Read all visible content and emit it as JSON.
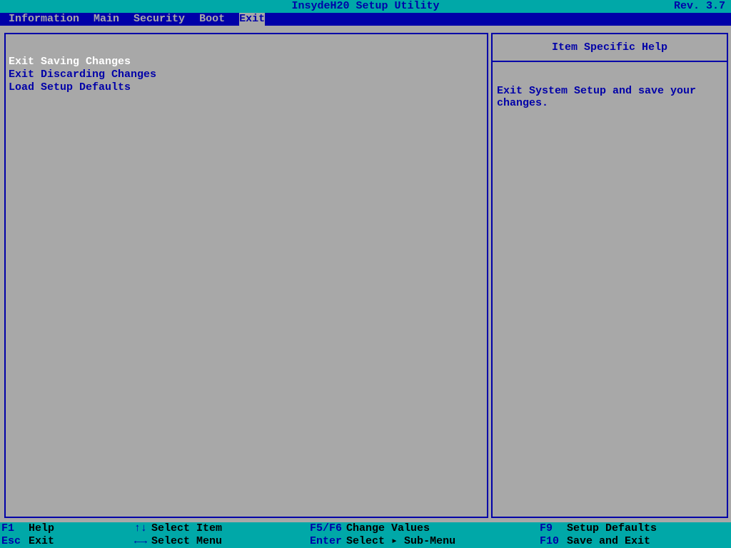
{
  "header": {
    "title": "InsydeH20 Setup Utility",
    "revision": "Rev. 3.7"
  },
  "menus": [
    {
      "label": "Information",
      "selected": false
    },
    {
      "label": "Main",
      "selected": false
    },
    {
      "label": "Security",
      "selected": false
    },
    {
      "label": "Boot",
      "selected": false
    },
    {
      "label": "Exit",
      "selected": true
    }
  ],
  "main": {
    "options": [
      {
        "label": "Exit Saving Changes",
        "selected": true
      },
      {
        "label": "Exit Discarding Changes",
        "selected": false
      },
      {
        "label": "Load Setup Defaults",
        "selected": false
      }
    ]
  },
  "help": {
    "title": "Item Specific Help",
    "body": "Exit System Setup and save your changes."
  },
  "footer": {
    "r1c1": {
      "key": "F1",
      "label": "Help"
    },
    "r1c2": {
      "key": "↑↓",
      "label": "Select Item"
    },
    "r1c3": {
      "key": "F5/F6",
      "label": "Change Values"
    },
    "r1c4": {
      "key": "F9",
      "label": "Setup Defaults"
    },
    "r2c1": {
      "key": "Esc",
      "label": "Exit"
    },
    "r2c2": {
      "key": "←→",
      "label": "Select Menu"
    },
    "r2c3": {
      "key": "Enter",
      "label": "Select ▸ Sub-Menu"
    },
    "r2c4": {
      "key": "F10",
      "label": "Save and Exit"
    }
  }
}
